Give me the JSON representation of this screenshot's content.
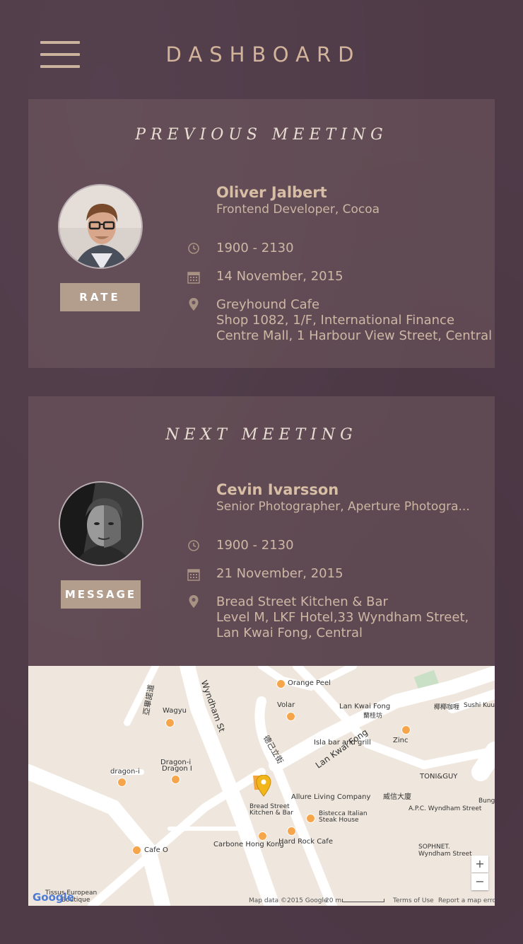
{
  "header": {
    "title": "DASHBOARD"
  },
  "previous": {
    "heading": "PREVIOUS MEETING",
    "name": "Oliver Jalbert",
    "role": "Frontend Developer, Cocoa",
    "time": "1900 - 2130",
    "date": "14 November, 2015",
    "location": [
      "Greyhound Cafe",
      "Shop 1082, 1/F, International Finance",
      "Centre Mall, 1 Harbour View Street, Central"
    ],
    "action_label": "RATE"
  },
  "next": {
    "heading": "NEXT MEETING",
    "name": "Cevin Ivarsson",
    "role": "Senior Photographer, Aperture Photogra...",
    "time": "1900 - 2130",
    "date": "21 November, 2015",
    "location": [
      "Bread Street Kitchen & Bar",
      "Level M, LKF Hotel,33 Wyndham Street,",
      "Lan Kwai Fong, Central"
    ],
    "action_label": "MESSAGE"
  },
  "map": {
    "streets": [
      "Wyndham St",
      "Lan Kwai Fong",
      "德己立街",
      "亞畢諾道"
    ],
    "places": [
      "Orange Peel",
      "Volar",
      "Lan Kwai Fong",
      "蘭桂坊",
      "Wagyu",
      "Isla bar and grill",
      "Zinc",
      "Dragon-i",
      "Dragon I",
      "dragon-i",
      "Allure Living Company",
      "Bread Street",
      "Kitchen & Bar",
      "Bistecca Italian",
      "Steak House",
      "威信大廈",
      "TONI&GUY",
      "A.P.C. Wyndham Street",
      "SOPHNET.",
      "Wyndham Street",
      "Carbone Hong Kong",
      "Hard Rock Cafe",
      "Cafe O",
      "Tissus European",
      "Boutique",
      "椰椰咖喱",
      "Sushi Kuu",
      "Bung"
    ],
    "attribution": "Map data ©2015 Google",
    "scale": "20 m",
    "terms": "Terms of Use",
    "report": "Report a map error",
    "logo": "Google",
    "zoom_in": "+",
    "zoom_out": "−"
  }
}
